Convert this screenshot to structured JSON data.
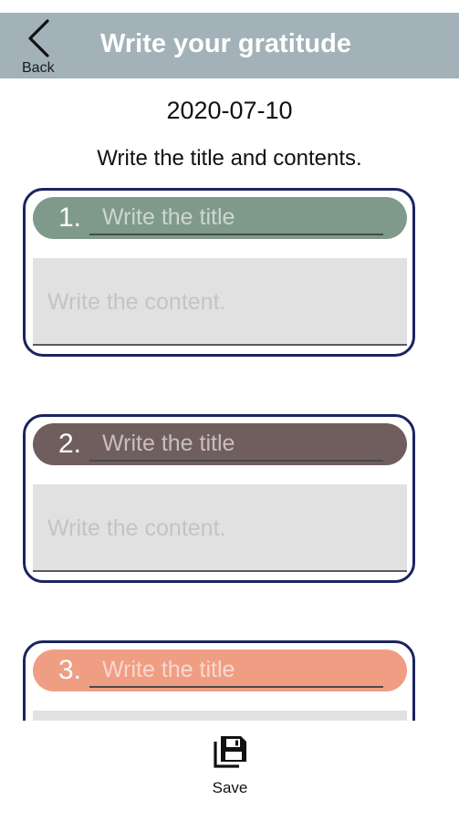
{
  "header": {
    "back_label": "Back",
    "title": "Write your gratitude",
    "bg_color": "#a3b1b8"
  },
  "date": "2020-07-10",
  "instruction": "Write the title and contents.",
  "entries": [
    {
      "number": "1.",
      "title_placeholder": "Write the title",
      "content_placeholder": "Write the content.",
      "color": "#7f9a8a"
    },
    {
      "number": "2.",
      "title_placeholder": "Write the title",
      "content_placeholder": "Write the content.",
      "color": "#705e5e"
    },
    {
      "number": "3.",
      "title_placeholder": "Write the title",
      "content_placeholder": "",
      "color": "#ef9e84"
    }
  ],
  "save": {
    "label": "Save",
    "icon": "floppy-disk-icon"
  },
  "card_border_color": "#1b2460"
}
